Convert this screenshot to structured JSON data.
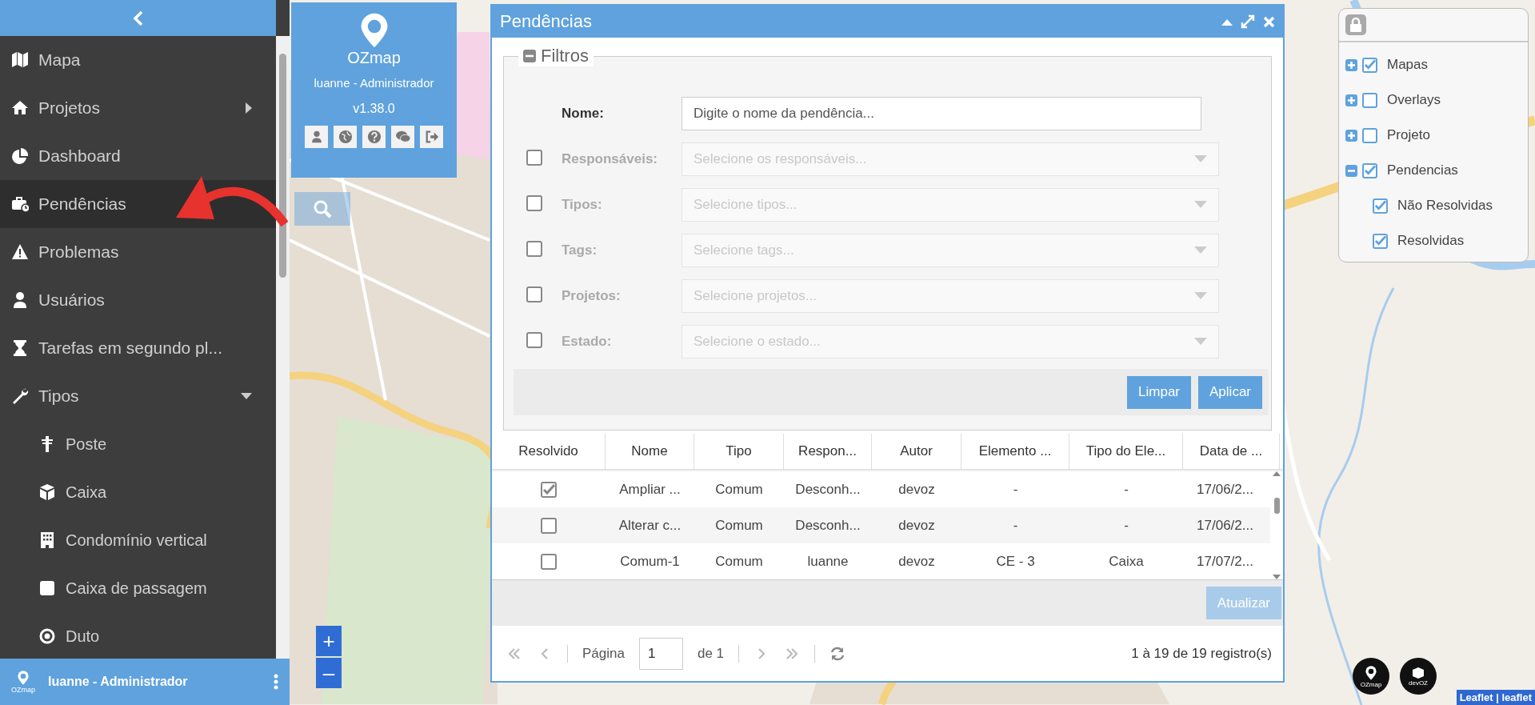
{
  "sidebar": {
    "items": [
      {
        "label": "Mapa",
        "kind": "link",
        "selected": false
      },
      {
        "label": "Projetos",
        "kind": "submenu",
        "selected": false
      },
      {
        "label": "Dashboard",
        "kind": "link",
        "selected": false
      },
      {
        "label": "Pendências",
        "kind": "link",
        "selected": true
      },
      {
        "label": "Problemas",
        "kind": "link",
        "selected": false
      },
      {
        "label": "Usuários",
        "kind": "link",
        "selected": false
      },
      {
        "label": "Tarefas em segundo pl...",
        "kind": "link",
        "selected": false
      },
      {
        "label": "Tipos",
        "kind": "group",
        "selected": false,
        "expanded": true,
        "children": [
          {
            "label": "Poste",
            "selected": false
          },
          {
            "label": "Caixa",
            "selected": false
          },
          {
            "label": "Condomínio vertical",
            "selected": false
          },
          {
            "label": "Caixa de passagem",
            "selected": false
          },
          {
            "label": "Duto",
            "selected": false
          }
        ]
      }
    ],
    "footer": {
      "logo": "OZmap",
      "user": "luanne - Administrador"
    }
  },
  "app_panel": {
    "logo": "OZmap",
    "user": "luanne - Administrador",
    "version": "v1.38.0"
  },
  "dialog": {
    "title": "Pendências",
    "filters": {
      "legend": "Filtros",
      "expanded": true,
      "name_label": "Nome:",
      "name_placeholder": "Digite o nome da pendência...",
      "rows": [
        {
          "label": "Responsáveis:",
          "placeholder": "Selecione os responsáveis...",
          "checked": false
        },
        {
          "label": "Tipos:",
          "placeholder": "Selecione tipos...",
          "checked": false
        },
        {
          "label": "Tags:",
          "placeholder": "Selecione tags...",
          "checked": false
        },
        {
          "label": "Projetos:",
          "placeholder": "Selecione projetos...",
          "checked": false
        },
        {
          "label": "Estado:",
          "placeholder": "Selecione o estado...",
          "checked": false
        }
      ],
      "buttons": [
        "Limpar",
        "Aplicar"
      ]
    },
    "table": {
      "columns": [
        "Resolvido",
        "Nome",
        "Tipo",
        "Respon...",
        "Autor",
        "Elemento ...",
        "Tipo do Ele...",
        "Data de ..."
      ],
      "rows": [
        {
          "cells": [
            {
              "kind": "checkbox",
              "checked": true
            },
            "Ampliar ...",
            "Comum",
            "Desconh...",
            "devoz",
            "-",
            "-",
            "17/06/2..."
          ]
        },
        {
          "cells": [
            {
              "kind": "checkbox",
              "checked": false
            },
            "Alterar c...",
            "Comum",
            "Desconh...",
            "devoz",
            "-",
            "-",
            "17/06/2..."
          ]
        },
        {
          "cells": [
            {
              "kind": "checkbox",
              "checked": false
            },
            "Comum-1",
            "Comum",
            "luanne",
            "devoz",
            "CE - 3",
            "Caixa",
            "17/07/2..."
          ]
        }
      ]
    },
    "update_button": {
      "label": "Atualizar",
      "disabled": true
    },
    "pager": {
      "page_label": "Página",
      "page": "1",
      "of": "de 1",
      "summary": "1 à 19 de 19 registro(s)"
    }
  },
  "layers": {
    "items": [
      {
        "label": "Mapas",
        "checked": true,
        "expanded": false
      },
      {
        "label": "Overlays",
        "checked": false,
        "expanded": false
      },
      {
        "label": "Projeto",
        "checked": false,
        "expanded": false
      },
      {
        "label": "Pendencias",
        "checked": true,
        "expanded": true,
        "children": [
          {
            "label": "Não Resolvidas",
            "checked": true
          },
          {
            "label": "Resolvidas",
            "checked": true
          }
        ]
      }
    ]
  },
  "zoom": [
    "+",
    "–"
  ],
  "logos": [
    "OZmap",
    "devOZ"
  ],
  "attribution": "Leaflet | leaflet"
}
